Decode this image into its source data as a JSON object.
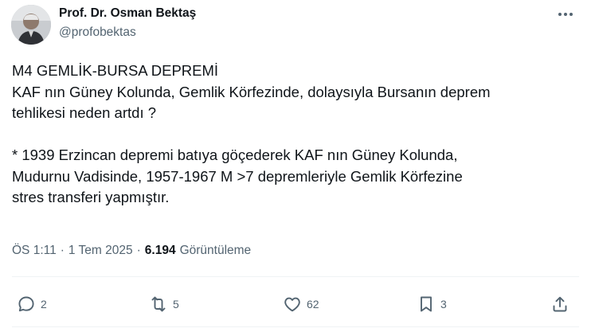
{
  "author": {
    "name": "Prof. Dr. Osman Bektaş",
    "handle": "@profobektas"
  },
  "tweet": {
    "lines": [
      "M4 GEMLİK-BURSA DEPREMİ",
      "KAF nın Güney Kolunda, Gemlik Körfezinde, dolaysıyla Bursanın deprem",
      "tehlikesi neden artdı ?",
      "",
      "* 1939 Erzincan depremi batıya göçederek KAF nın Güney Kolunda,",
      "Mudurnu Vadisinde, 1957-1967 M >7 depremleriyle Gemlik Körfezine",
      "stres transferi yapmıştır."
    ]
  },
  "meta": {
    "time": "ÖS 1:11",
    "separator": "·",
    "date": "1 Tem 2025",
    "views_count": "6.194",
    "views_label": "Görüntüleme"
  },
  "actions": {
    "reply_count": "2",
    "retweet_count": "5",
    "like_count": "62",
    "bookmark_count": "3"
  },
  "icons": [
    "more-icon",
    "reply-icon",
    "retweet-icon",
    "like-icon",
    "bookmark-icon",
    "share-icon"
  ],
  "colors": {
    "text": "#0f1419",
    "secondary": "#536471",
    "divider": "#eff3f4"
  }
}
